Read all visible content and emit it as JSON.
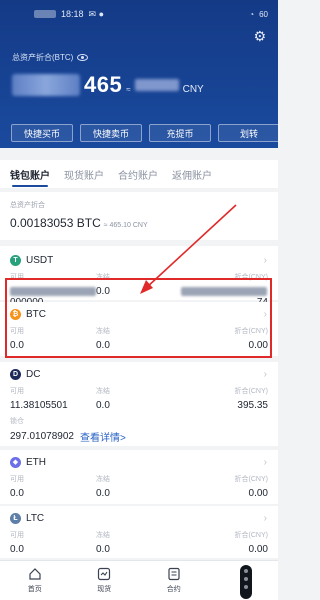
{
  "status_bar": {
    "time": "18:18",
    "battery": "60"
  },
  "header": {
    "assets_label": "总资产折合(BTC)",
    "amount_visible": "465",
    "approx_symbol": "≈",
    "currency": "CNY",
    "quick_actions": [
      "快捷买币",
      "快捷卖币",
      "充提币",
      "划转"
    ]
  },
  "tabs": [
    "钱包账户",
    "现货账户",
    "合约账户",
    "返佣账户"
  ],
  "summary": {
    "label": "总资产折合",
    "btc_amount": "0.00183053 BTC",
    "cny_amount": "≈ 465.10 CNY"
  },
  "columns": {
    "available": "可用",
    "frozen": "冻结",
    "converted": "折合(CNY)"
  },
  "coins": [
    {
      "name": "USDT",
      "available": "000000",
      "frozen": "0.0",
      "converted": "74",
      "icon_color": "#26a17b",
      "icon": "usdt-icon",
      "glyph": "T"
    },
    {
      "name": "BTC",
      "available": "0.0",
      "frozen": "0.0",
      "converted": "0.00",
      "icon_color": "#f7931a",
      "icon": "bitcoin-icon",
      "glyph": "₿"
    },
    {
      "name": "DC",
      "available": "11.38105501",
      "frozen": "0.0",
      "converted": "395.35",
      "icon_color": "#1e2a5a",
      "icon": "dc-icon",
      "glyph": "D",
      "locked_label": "锁仓",
      "locked_value": "297.01078902",
      "details_link": "查看详情>"
    },
    {
      "name": "ETH",
      "available": "0.0",
      "frozen": "0.0",
      "converted": "0.00",
      "icon_color": "#6b6fe8",
      "icon": "ethereum-icon",
      "glyph": "◆"
    },
    {
      "name": "LTC",
      "available": "0.0",
      "frozen": "0.0",
      "converted": "0.00",
      "icon_color": "#5d7fa8",
      "icon": "litecoin-icon",
      "glyph": "Ł"
    }
  ],
  "bottom_nav": [
    "首页",
    "现货",
    "合约"
  ],
  "colors": {
    "header_bg": "#1a4a9e",
    "highlight": "#e02a2a",
    "link": "#2962c4"
  }
}
